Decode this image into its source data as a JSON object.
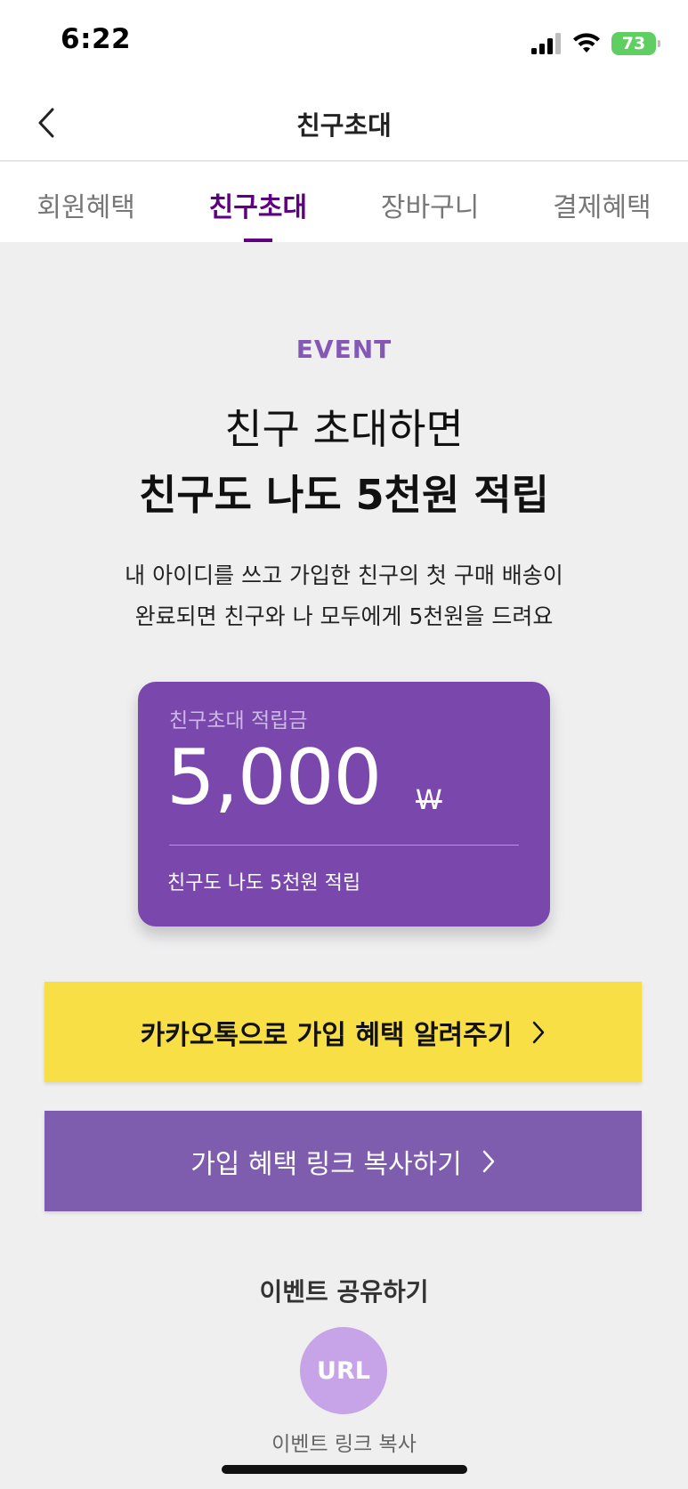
{
  "status_bar": {
    "time": "6:22",
    "battery": "73"
  },
  "nav": {
    "title": "친구초대"
  },
  "tabs": [
    {
      "label": "회원혜택",
      "active": false
    },
    {
      "label": "친구초대",
      "active": true
    },
    {
      "label": "장바구니",
      "active": false
    },
    {
      "label": "결제혜택",
      "active": false
    }
  ],
  "event": {
    "label": "EVENT",
    "headline_line1": "친구 초대하면",
    "headline_line2": "친구도 나도 5천원 적립",
    "description_line1": "내 아이디를 쓰고 가입한 친구의 첫 구매 배송이",
    "description_line2": "완료되면 친구와 나 모두에게 5천원을 드려요"
  },
  "reward_card": {
    "label": "친구초대 적립금",
    "amount": "5,000",
    "currency": "W",
    "caption": "친구도 나도 5천원 적립"
  },
  "buttons": {
    "kakao_label": "카카오톡으로 가입 혜택 알려주기",
    "link_label": "가입 혜택 링크 복사하기"
  },
  "share": {
    "title": "이벤트 공유하기",
    "url_label": "URL",
    "url_caption": "이벤트 링크 복사"
  },
  "colors": {
    "brand_purple": "#5f0080",
    "card_purple": "#7a48ad",
    "kakao_yellow": "#f8df46",
    "link_purple": "#7f5dae"
  }
}
